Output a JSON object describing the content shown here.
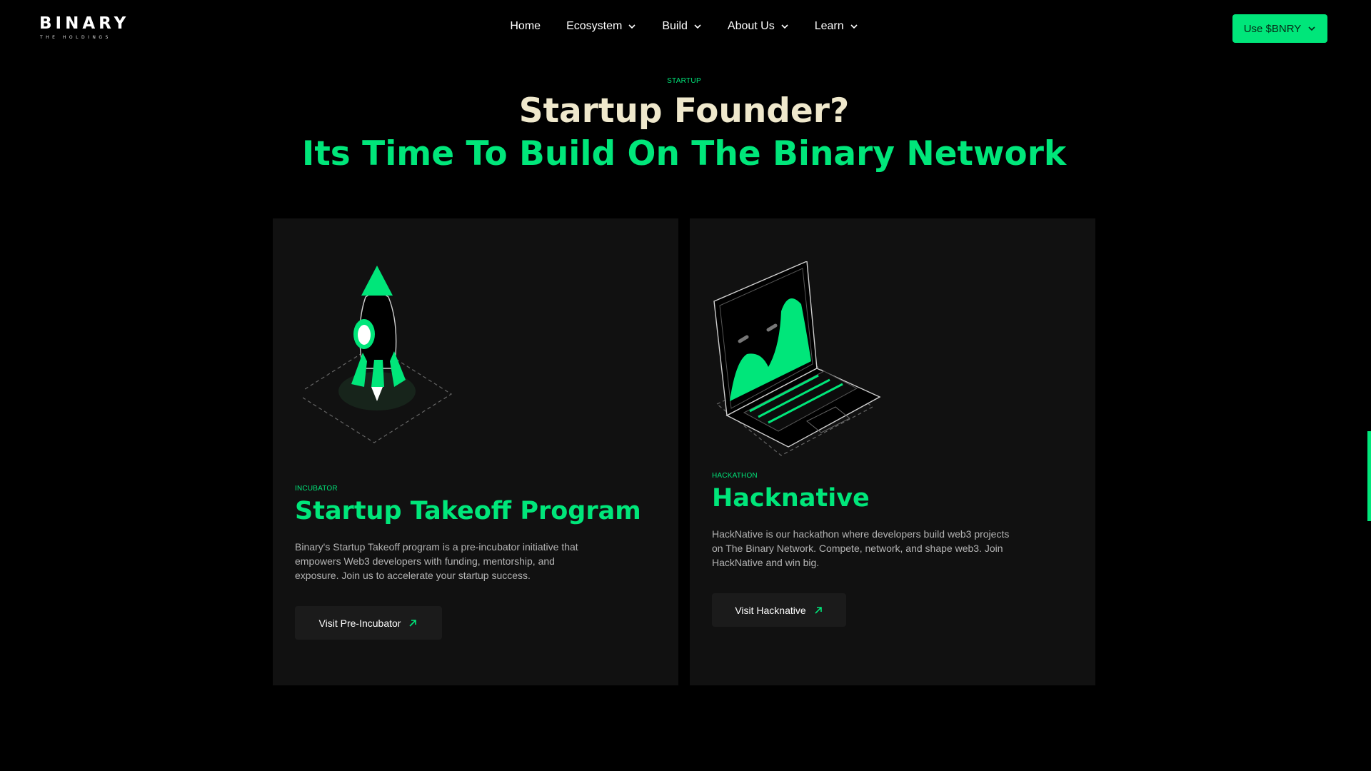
{
  "brand": {
    "name": "BINARY",
    "tagline": "THE HOLDINGS"
  },
  "nav": {
    "items": [
      {
        "label": "Home",
        "dropdown": false
      },
      {
        "label": "Ecosystem",
        "dropdown": true
      },
      {
        "label": "Build",
        "dropdown": true
      },
      {
        "label": "About Us",
        "dropdown": true
      },
      {
        "label": "Learn",
        "dropdown": true
      }
    ],
    "cta_label": "Use $BNRY"
  },
  "hero": {
    "eyebrow": "STARTUP",
    "title_line1": "Startup Founder?",
    "title_line2": "Its Time To Build On The Binary Network"
  },
  "cards": [
    {
      "tag": "INCUBATOR",
      "title": "Startup Takeoff Program",
      "description": "Binary's Startup Takeoff program is a pre-incubator initiative that empowers Web3 developers with funding, mentorship, and exposure. Join us to accelerate your startup success.",
      "button_label": "Visit Pre-Incubator",
      "illustration": "rocket-icon"
    },
    {
      "tag": "HACKATHON",
      "title": "Hacknative",
      "description": "HackNative is our hackathon where developers build web3 projects on The Binary Network. Compete, network, and shape web3. Join HackNative and win big.",
      "button_label": "Visit Hacknative",
      "illustration": "laptop-icon"
    }
  ],
  "colors": {
    "accent": "#00e67a",
    "background": "#000000",
    "card": "#111111",
    "cream": "#efe8cc"
  }
}
